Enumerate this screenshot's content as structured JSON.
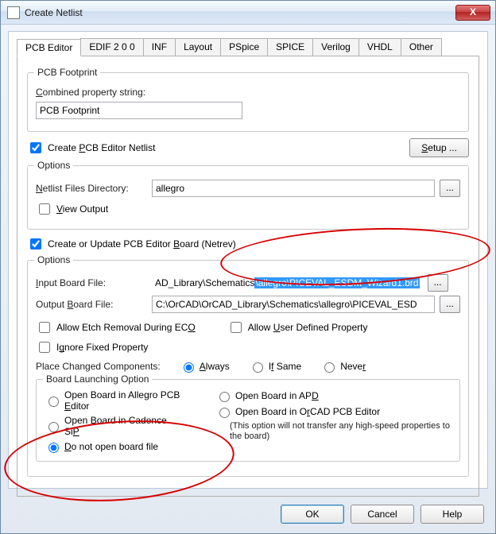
{
  "window": {
    "title": "Create Netlist",
    "close_glyph": "X"
  },
  "tabs": [
    "PCB Editor",
    "EDIF 2 0 0",
    "INF",
    "Layout",
    "PSpice",
    "SPICE",
    "Verilog",
    "VHDL",
    "Other"
  ],
  "footprint": {
    "group_label": "PCB Footprint",
    "combined_label": "Combined property string:",
    "combined_value": "PCB Footprint"
  },
  "create_netlist_label": "Create PCB Editor Netlist",
  "create_netlist_checked": true,
  "setup_button": "Setup ...",
  "options1": {
    "group_label": "Options",
    "dir_label": "Netlist Files Directory:",
    "dir_value": "allegro",
    "browse_glyph": "...",
    "view_output_label": "View Output",
    "view_output_checked": false
  },
  "create_update_label": "Create or Update PCB Editor Board (Netrev)",
  "create_update_checked": true,
  "options2": {
    "group_label": "Options",
    "input_label": "Input Board File:",
    "input_prefix": "AD_Library\\Schematics",
    "input_selected": "\\allegro\\PICEVAL_ESDM_Wizard1.brd",
    "output_label": "Output Board File:",
    "output_value": "C:\\OrCAD\\OrCAD_Library\\Schematics\\allegro\\PICEVAL_ESD",
    "browse_glyph": "...",
    "allow_etch_label": "Allow Etch Removal During ECO",
    "allow_etch_checked": false,
    "allow_user_prop_label": "Allow User Defined Property",
    "allow_user_prop_checked": false,
    "ignore_fixed_label": "Ignore Fixed Property",
    "ignore_fixed_checked": false,
    "place_changed_label": "Place Changed Components:",
    "place_changed_options": [
      "Always",
      "If Same",
      "Never"
    ],
    "place_changed_selected": 0
  },
  "launch": {
    "group_label": "Board Launching Option",
    "left": [
      "Open Board in Allegro PCB Editor",
      "Open Board in Cadence SiP",
      "Do not open board file"
    ],
    "right": [
      "Open Board in APD",
      "Open Board in OrCAD PCB Editor"
    ],
    "right_note": "(This option will not transfer any high-speed properties to the board)",
    "selected": "Do not open board file"
  },
  "buttons": {
    "ok": "OK",
    "cancel": "Cancel",
    "help": "Help"
  }
}
